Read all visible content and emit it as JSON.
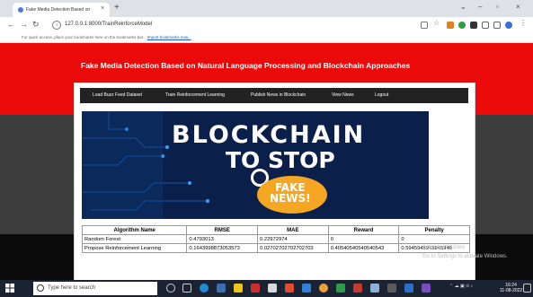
{
  "browser": {
    "tab_title": "Fake Media Detection Based on",
    "tab_close": "×",
    "new_tab": "+",
    "window_controls": [
      "⌄",
      "–",
      "▫",
      "×"
    ],
    "url": "127.0.0.1:8000/TrainReinforceModel",
    "bookmark_hint": "For quick access, place your bookmarks here on the bookmarks bar.",
    "bookmark_link": "Import bookmarks now..."
  },
  "page": {
    "title": "Fake Media Detection Based on Natural Language Processing and Blockchain Approaches",
    "menu": [
      "Load Buzz Feed Dataset",
      "Train Reinforcement Learning",
      "Publish News in Blockchain",
      "View News",
      "Logout"
    ],
    "banner": {
      "line1": "BLOCKCHAIN",
      "line2": "TO STOP",
      "badge_line1": "FAKE",
      "badge_line2": "NEWS!"
    },
    "table": {
      "headers": [
        "Algorithm Name",
        "RMSE",
        "MAE",
        "Reward",
        "Penalty"
      ],
      "rows": [
        [
          "Random Forest",
          "0.4793013",
          "0.22972974",
          "0",
          "0"
        ],
        [
          "Propose Reinforcement Learning",
          "0.1643998873053573",
          "0.02702702702702703",
          "0.40540540540540543",
          "0.5945945945945946"
        ]
      ]
    },
    "watermark": {
      "line1": "Activate Windows",
      "line2": "Go to Settings to activate Windows."
    }
  },
  "taskbar": {
    "search_placeholder": "Type here to search",
    "time": "16:24",
    "date": "11-08-2022"
  },
  "colors": {
    "header_red": "#ea0a0a",
    "menu_bg": "#222222",
    "banner_navy": "#0a1f4a",
    "badge_orange": "#f5a623",
    "taskbar": "#1b2231"
  }
}
